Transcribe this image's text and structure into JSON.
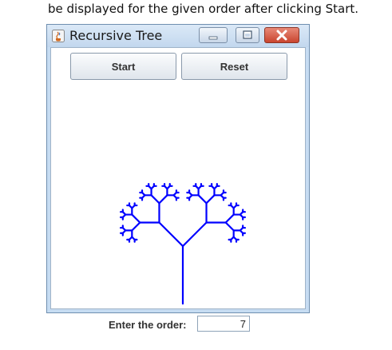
{
  "caption": "be displayed for the given order after clicking Start.",
  "window": {
    "title": "Recursive Tree",
    "buttons": {
      "start": "Start",
      "reset": "Reset"
    },
    "order_label": "Enter the order:",
    "order_value": "7",
    "tree_color": "#0000ff"
  }
}
